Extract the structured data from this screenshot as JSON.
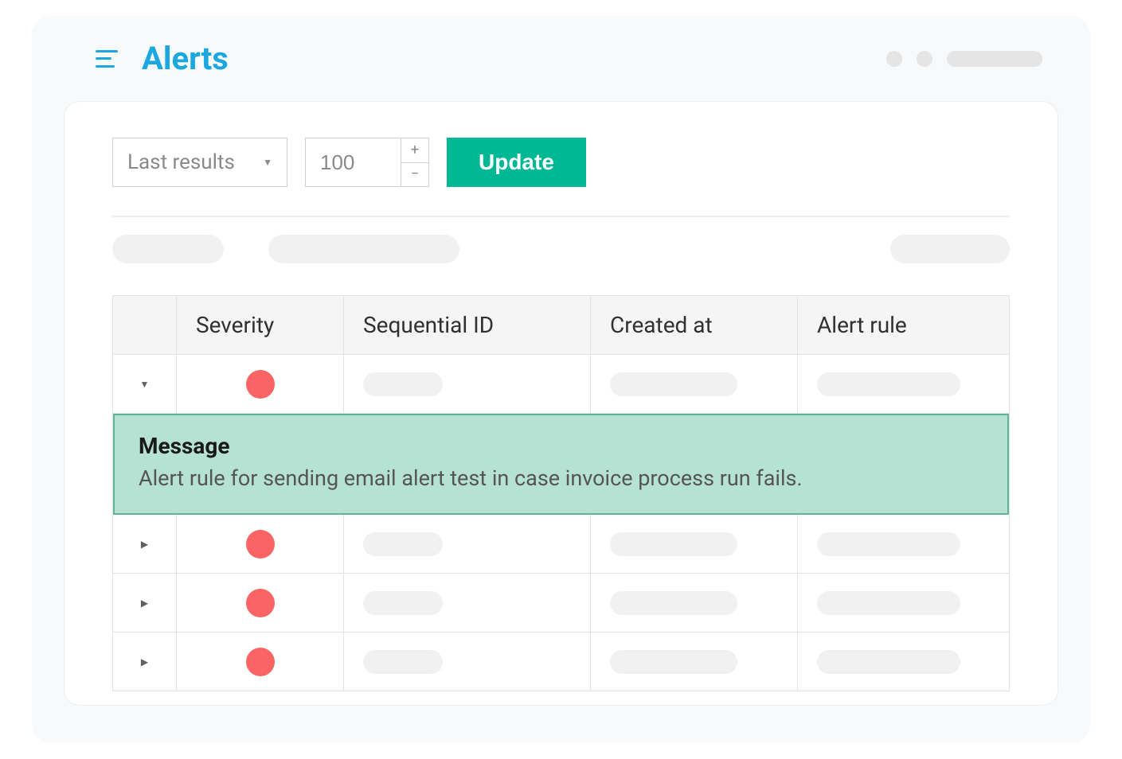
{
  "header": {
    "title": "Alerts"
  },
  "controls": {
    "filter_select": "Last results",
    "count_value": "100",
    "update_label": "Update"
  },
  "table": {
    "headers": {
      "severity": "Severity",
      "sequential_id": "Sequential ID",
      "created_at": "Created at",
      "alert_rule": "Alert rule"
    }
  },
  "rows": [
    {
      "expanded": true,
      "severity_color": "#fa6464"
    },
    {
      "expanded": false,
      "severity_color": "#fa6464"
    },
    {
      "expanded": false,
      "severity_color": "#fa6464"
    },
    {
      "expanded": false,
      "severity_color": "#fa6464"
    }
  ],
  "message_panel": {
    "title": "Message",
    "body": "Alert rule for sending email alert test in case invoice process run fails."
  }
}
